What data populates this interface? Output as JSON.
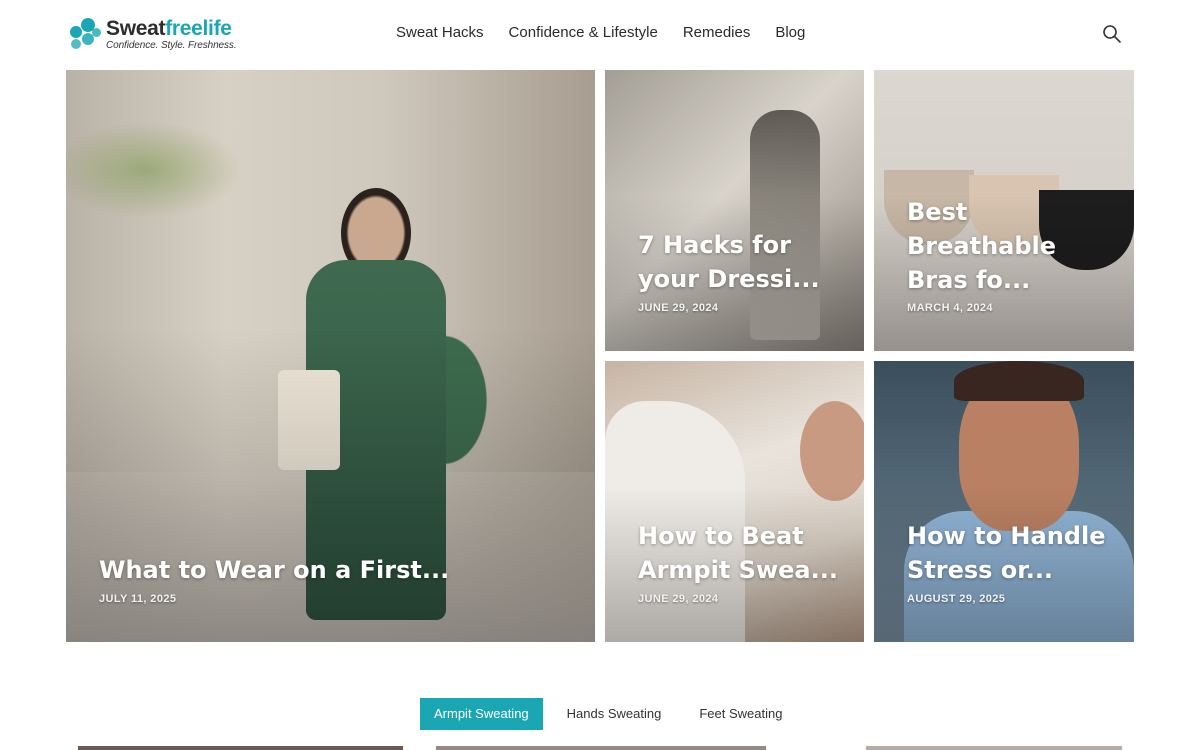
{
  "brand": {
    "name_part1": "Sweat",
    "name_part2": "freelife",
    "tagline": "Confidence. Style. Freshness.",
    "accent_color": "#1aa7b3"
  },
  "nav": {
    "items": [
      {
        "label": "Sweat Hacks"
      },
      {
        "label": "Confidence & Lifestyle"
      },
      {
        "label": "Remedies"
      },
      {
        "label": "Blog"
      }
    ],
    "search_icon": "search-icon"
  },
  "posts": [
    {
      "title": "What to Wear on a First...",
      "date": "JULY 11, 2025"
    },
    {
      "title": "7 Hacks for your Dressi...",
      "date": "JUNE 29, 2024"
    },
    {
      "title": "Best Breathable Bras fo...",
      "date": "MARCH 4, 2024"
    },
    {
      "title": "How to Beat Armpit Swea...",
      "date": "JUNE 29, 2024"
    },
    {
      "title": "How to Handle Stress or...",
      "date": "AUGUST 29, 2025"
    }
  ],
  "tabs": [
    {
      "label": "Armpit Sweating",
      "active": true
    },
    {
      "label": "Hands Sweating",
      "active": false
    },
    {
      "label": "Feet Sweating",
      "active": false
    }
  ]
}
